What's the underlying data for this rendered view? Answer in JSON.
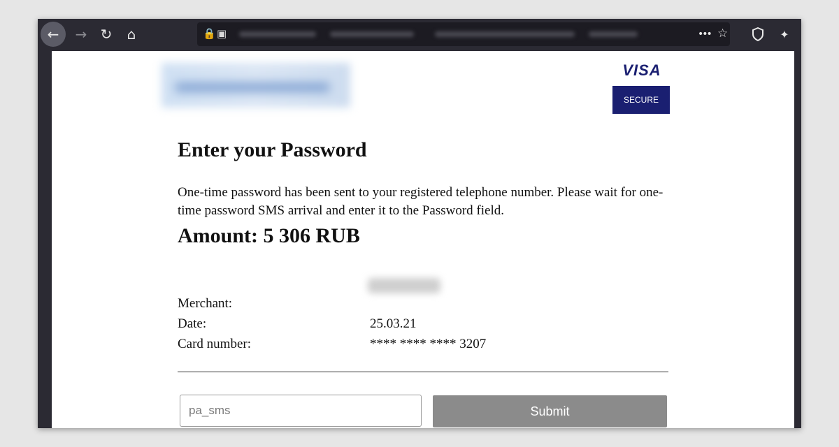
{
  "browser": {
    "toolbar": {
      "back_icon": "arrow-left",
      "forward_icon": "arrow-right",
      "reload_icon": "reload",
      "home_icon": "home"
    },
    "urlbar": {
      "lock_icon": "lock",
      "page_icon": "image",
      "more_label": "•••",
      "bookmark_icon": "star",
      "shield_icon": "shield",
      "extension_icon": "brush"
    }
  },
  "brand": {
    "visa_label": "VISA",
    "secure_label": "SECURE",
    "visa_color": "#1a1f71"
  },
  "page": {
    "title": "Enter your Password",
    "description": "One-time password has been sent to your registered telephone number. Please wait for one-time password SMS arrival and enter it to the Password field.",
    "amount": "Amount: 5 306 RUB"
  },
  "details": {
    "merchant_label": "Merchant:",
    "date_label": "Date:",
    "date_value": "25.03.21",
    "card_label": "Card number:",
    "card_value": "**** **** **** 3207"
  },
  "form": {
    "password_placeholder": "pa_sms",
    "submit_label": "Submit"
  }
}
